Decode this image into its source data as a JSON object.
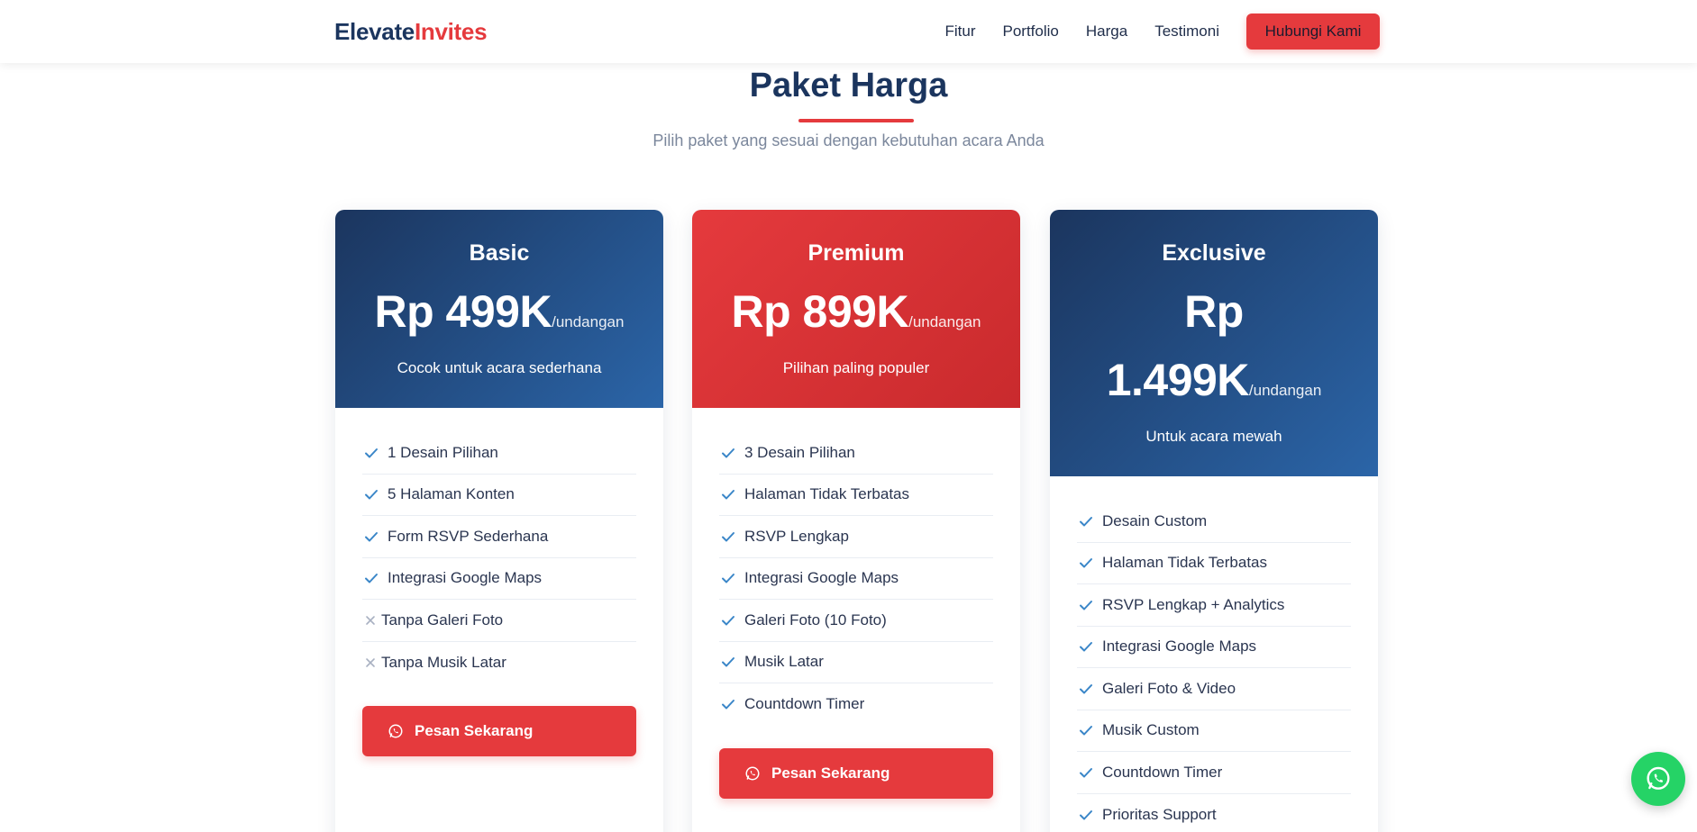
{
  "brand": {
    "part1": "Elevate",
    "part2": "Invites"
  },
  "nav": {
    "links": [
      "Fitur",
      "Portfolio",
      "Harga",
      "Testimoni"
    ],
    "cta": "Hubungi Kami"
  },
  "section": {
    "title": "Paket Harga",
    "subtitle": "Pilih paket yang sesuai dengan kebutuhan acara Anda"
  },
  "plans": [
    {
      "name": "Basic",
      "price": "Rp 499K",
      "unit": "/undangan",
      "desc": "Cocok untuk acara sederhana",
      "features": [
        {
          "text": "1 Desain Pilihan",
          "included": true
        },
        {
          "text": "5 Halaman Konten",
          "included": true
        },
        {
          "text": "Form RSVP Sederhana",
          "included": true
        },
        {
          "text": "Integrasi Google Maps",
          "included": true
        },
        {
          "text": "Tanpa Galeri Foto",
          "included": false
        },
        {
          "text": "Tanpa Musik Latar",
          "included": false
        }
      ],
      "button": "Pesan Sekarang"
    },
    {
      "name": "Premium",
      "price": "Rp 899K",
      "unit": "/undangan",
      "desc": "Pilihan paling populer",
      "features": [
        {
          "text": "3 Desain Pilihan",
          "included": true
        },
        {
          "text": "Halaman Tidak Terbatas",
          "included": true
        },
        {
          "text": "RSVP Lengkap",
          "included": true
        },
        {
          "text": "Integrasi Google Maps",
          "included": true
        },
        {
          "text": "Galeri Foto (10 Foto)",
          "included": true
        },
        {
          "text": "Musik Latar",
          "included": true
        },
        {
          "text": "Countdown Timer",
          "included": true
        }
      ],
      "button": "Pesan Sekarang"
    },
    {
      "name": "Exclusive",
      "price_line1": "Rp",
      "price_line2": "1.499K",
      "unit": "/undangan",
      "desc": "Untuk acara mewah",
      "features": [
        {
          "text": "Desain Custom",
          "included": true
        },
        {
          "text": "Halaman Tidak Terbatas",
          "included": true
        },
        {
          "text": "RSVP Lengkap + Analytics",
          "included": true
        },
        {
          "text": "Integrasi Google Maps",
          "included": true
        },
        {
          "text": "Galeri Foto & Video",
          "included": true
        },
        {
          "text": "Musik Custom",
          "included": true
        },
        {
          "text": "Countdown Timer",
          "included": true
        },
        {
          "text": "Prioritas Support",
          "included": true
        }
      ]
    }
  ],
  "icons": {
    "check": "check-icon",
    "cross": "cross-icon",
    "whatsapp": "whatsapp-icon"
  },
  "colors": {
    "navy": "#1b355e",
    "blue": "#2b65a8",
    "red": "#e53a3d",
    "check": "#3a86c8",
    "whatsapp": "#25d366"
  }
}
